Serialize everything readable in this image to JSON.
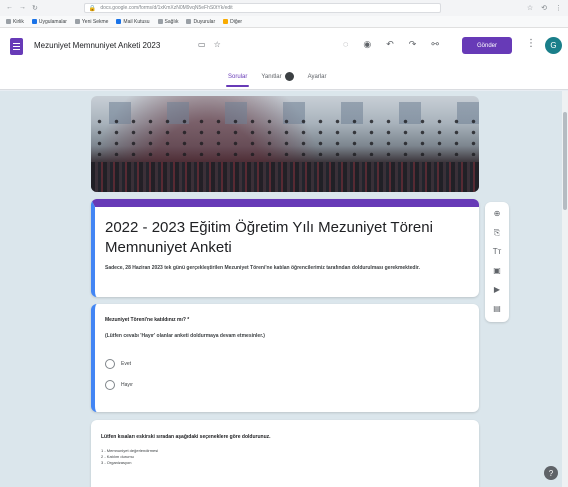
{
  "browser": {
    "url": "docs.google.com/forms/d/1xKmXzN0M9vqN5eFhS0tYk/edit",
    "nav_icons": {
      "back": "←",
      "forward": "→",
      "reload": "↻"
    },
    "right_icons": [
      "☆",
      "⟲",
      "⋮"
    ]
  },
  "bookmarks": [
    {
      "label": "Kirlik",
      "icon": "bookmark-icon"
    },
    {
      "label": "Uygulamalar",
      "icon": "apps-icon"
    },
    {
      "label": "Yeni Sekme",
      "icon": "bookmark-icon"
    },
    {
      "label": "Mail Kutusu",
      "icon": "mail-icon"
    },
    {
      "label": "Sağlık",
      "icon": "bookmark-icon"
    },
    {
      "label": "Duyurular",
      "icon": "bookmark-icon"
    },
    {
      "label": "Diğer",
      "icon": "folder-icon"
    }
  ],
  "header": {
    "doc_title": "Mezuniyet Memnuniyet Anketi 2023",
    "folder_icon": "▭",
    "star_icon": "☆",
    "tool_icons": {
      "palette": "◌",
      "preview": "◉",
      "undo": "↶",
      "redo": "↷",
      "link": "⚯"
    },
    "send_label": "Gönder",
    "more_icon": "⋮",
    "avatar_letter": "G"
  },
  "tabs": [
    {
      "label": "Sorular",
      "active": true
    },
    {
      "label": "Yanıtlar",
      "active": false
    },
    {
      "label": "Ayarlar",
      "active": false
    }
  ],
  "form": {
    "title": "2022 - 2023 Eğitim Öğretim Yılı Mezuniyet Töreni Memnuniyet Anketi",
    "description": "Sadece, 28 Haziran 2023 tek günü gerçekleştirilen Mezuniyet Töreni'ne katılan öğrencilerimiz tarafından doldurulması gerekmektedir."
  },
  "question1": {
    "title": "Mezuniyet Töreni'ne katıldınız mı? *",
    "subtitle": "(Lütfen cevabı 'Hayır' olanlar anketi doldurmaya devam etmesinler.)",
    "options": [
      "Evet",
      "Hayır"
    ]
  },
  "question2": {
    "title": "Lütfen kısaları eskirski sıradan aşağıdaki seçeneklere göre doldurunuz.",
    "items": [
      "1 - Memnuniyet değerlendirmesi",
      "2 - Katılım durumu",
      "3 - Organizasyon"
    ]
  },
  "side_toolbar": {
    "add": "⊕",
    "import": "⎘",
    "title_text": "Tт",
    "image": "▣",
    "video": "▶",
    "section": "▤"
  },
  "help_icon": "?"
}
